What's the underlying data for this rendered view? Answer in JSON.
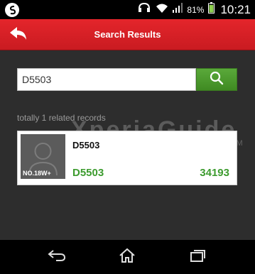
{
  "status_bar": {
    "battery_percent": "81%",
    "time": "10:21",
    "icons": [
      "sync-icon",
      "headset-icon",
      "wifi-icon",
      "signal-icon",
      "battery-icon"
    ]
  },
  "header": {
    "title": "Search Results",
    "back_icon": "back-arrow-icon",
    "color": "#d8202a"
  },
  "search": {
    "value": "D5503",
    "button_icon": "search-icon",
    "button_color": "#4a9a2d"
  },
  "results": {
    "summary": "totally 1 related records",
    "items": [
      {
        "avatar_label": "NO.18W+",
        "title": "D5503",
        "model": "D5503",
        "score": "34193"
      }
    ]
  },
  "watermark": {
    "text": "XperiaGuide",
    "suffix": ".COM"
  },
  "nav_bar": {
    "buttons": [
      "back-icon",
      "home-icon",
      "recent-apps-icon"
    ]
  }
}
